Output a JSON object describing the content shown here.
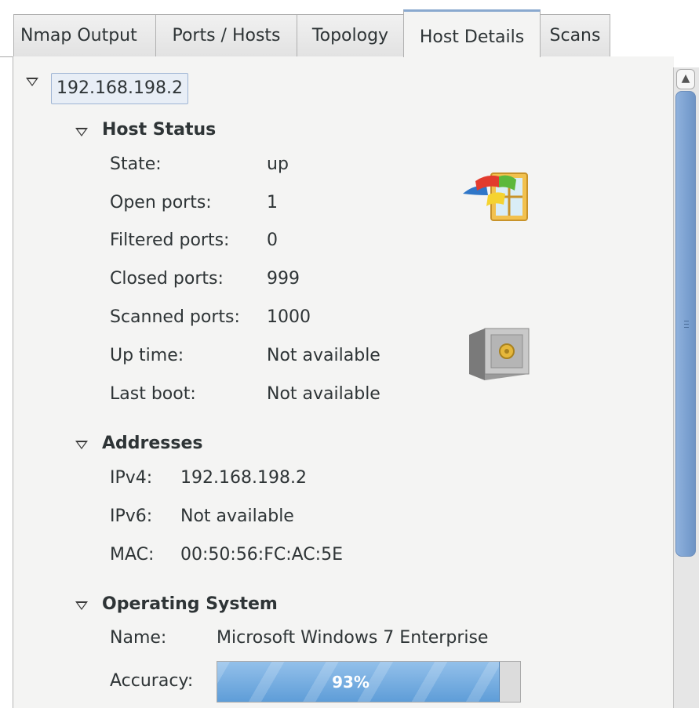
{
  "tabs": [
    "Nmap Output",
    "Ports / Hosts",
    "Topology",
    "Host Details",
    "Scans"
  ],
  "active_tab": "Host Details",
  "host": {
    "ip": "192.168.198.2",
    "sections": {
      "host_status": {
        "title": "Host Status",
        "state_label": "State:",
        "state_value": "up",
        "open_label": "Open ports:",
        "open_value": "1",
        "filtered_label": "Filtered ports:",
        "filtered_value": "0",
        "closed_label": "Closed ports:",
        "closed_value": "999",
        "scanned_label": "Scanned ports:",
        "scanned_value": "1000",
        "uptime_label": "Up time:",
        "uptime_value": "Not available",
        "lastboot_label": "Last boot:",
        "lastboot_value": "Not available",
        "os_icon": "windows-os-icon",
        "vulnerability_icon": "safe-icon"
      },
      "addresses": {
        "title": "Addresses",
        "ipv4_label": "IPv4:",
        "ipv4_value": "192.168.198.2",
        "ipv6_label": "IPv6:",
        "ipv6_value": "Not available",
        "mac_label": "MAC:",
        "mac_value": "00:50:56:FC:AC:5E"
      },
      "operating_system": {
        "title": "Operating System",
        "name_label": "Name:",
        "name_value": "Microsoft Windows 7 Enterprise",
        "accuracy_label": "Accuracy:",
        "accuracy_value": "93%",
        "accuracy_fraction": 0.93
      }
    }
  },
  "colors": {
    "tab_active_accent": "#8aa9cf",
    "progress_fill": "#6fa7dd",
    "scrollbar_thumb": "#7aa0d0"
  }
}
